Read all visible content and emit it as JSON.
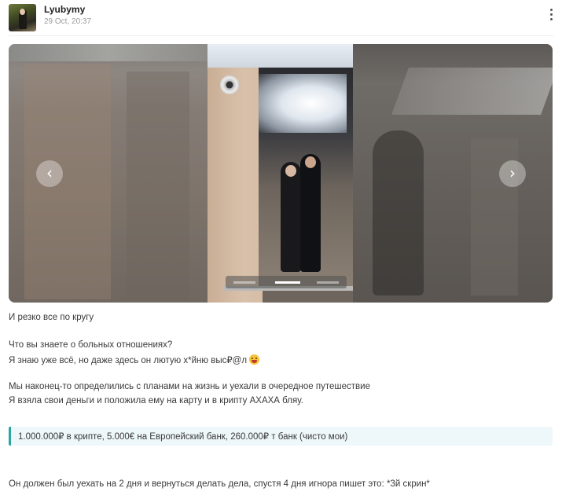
{
  "post": {
    "author": "Lyubymy",
    "date": "29 Oct, 20:37"
  },
  "icons": {
    "menu": "more-vertical-icon",
    "prev": "chevron-left-icon",
    "next": "chevron-right-icon",
    "emoji": "tongue-out-emoji-icon"
  },
  "gallery": {
    "prev_glyph": "‹",
    "next_glyph": "›",
    "slide_count": 3,
    "active_slide": 2
  },
  "body": {
    "line1": "И резко все по кругу",
    "line2": "Что вы знаете о больных отношениях?",
    "line3": "Я знаю уже всё, но даже здесь он лютую х*йню выс₽@л",
    "line4": "Мы наконец-то определились с планами на жизнь и уехали в очередное путешествие",
    "line5": "Я взяла свои деньги и положила ему на карту и в крипту АХАХА бляу.",
    "quote": "1.000.000₽ в крипте, 5.000€ на Европейский банк, 260.000₽ т банк (чисто мои)",
    "line6": "Он должен был уехать на 2 дня и вернуться делать дела, спустя 4 дня игнора пишет это: *3й скрин*"
  },
  "colors": {
    "quote_accent": "#2aa7a1",
    "quote_background": "#eef7f9",
    "date_text": "#9a9a9a"
  }
}
